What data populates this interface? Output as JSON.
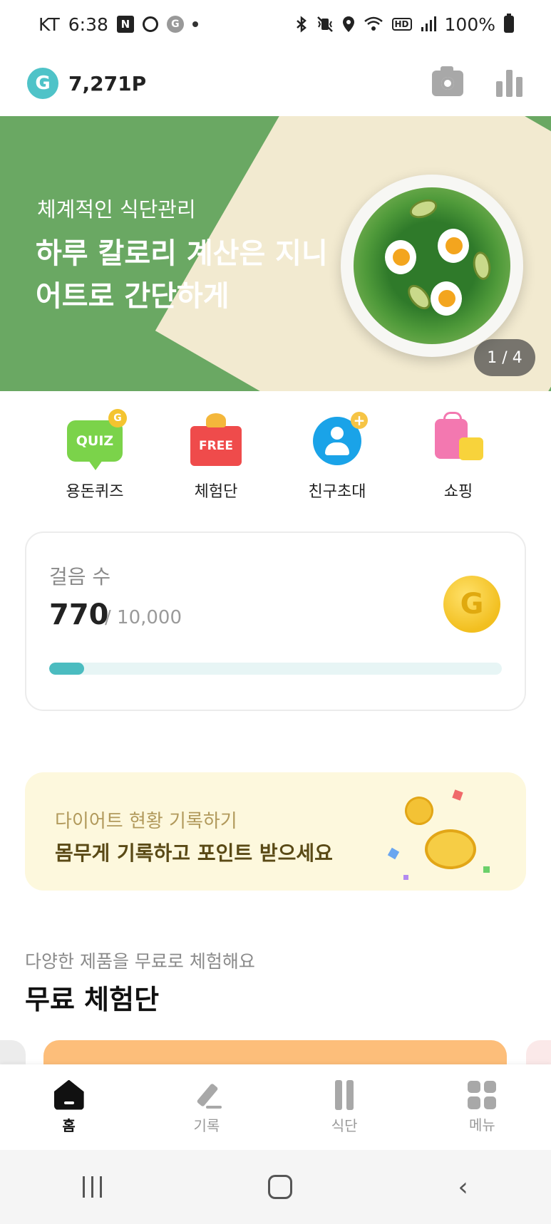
{
  "status_bar": {
    "carrier": "KT",
    "time": "6:38",
    "n_icon": "N",
    "g_icon": "G",
    "hd": "HD",
    "battery": "100%",
    "icons": [
      "bluetooth-icon",
      "vibrate-icon",
      "location-icon",
      "wifi-icon",
      "signal-icon",
      "battery-icon"
    ]
  },
  "header": {
    "badge": "G",
    "points": "7,271P",
    "icons": [
      "camera-icon",
      "stats-chart-icon"
    ]
  },
  "banner": {
    "subtitle": "체계적인 식단관리",
    "title": "하루 칼로리 계산은 지니어트로 간단하게",
    "page_indicator": "1 / 4",
    "colors": {
      "green": "#6aa863",
      "cream": "#f2ead0"
    }
  },
  "quick_menu": {
    "items": [
      {
        "label": "용돈퀴즈",
        "badge": "QUIZ",
        "mini_badge": "G",
        "icon": "quiz-bubble-icon"
      },
      {
        "label": "체험단",
        "badge": "FREE",
        "icon": "gift-box-icon"
      },
      {
        "label": "친구초대",
        "plus": "+",
        "icon": "invite-friend-icon"
      },
      {
        "label": "쇼핑",
        "icon": "shopping-bag-icon"
      }
    ]
  },
  "steps": {
    "label": "걸음 수",
    "value": "770",
    "goal": "/ 10,000",
    "coin": "G",
    "progress_fraction": 0.077,
    "accent": "#4bbcc0"
  },
  "record_banner": {
    "subtitle": "다이어트 현황 기록하기",
    "title": "몸무게 기록하고 포인트 받으세요",
    "icon": "coins-icon"
  },
  "free_trial": {
    "subtitle": "다양한 제품을 무료로 체험해요",
    "title": "무료 체험단"
  },
  "bottom_nav": {
    "items": [
      {
        "label": "홈",
        "icon": "home-icon",
        "active": true
      },
      {
        "label": "기록",
        "icon": "pencil-icon",
        "active": false
      },
      {
        "label": "식단",
        "icon": "fork-knife-icon",
        "active": false
      },
      {
        "label": "메뉴",
        "icon": "grid-icon",
        "active": false
      }
    ]
  },
  "system_nav": {
    "back": "‹"
  }
}
